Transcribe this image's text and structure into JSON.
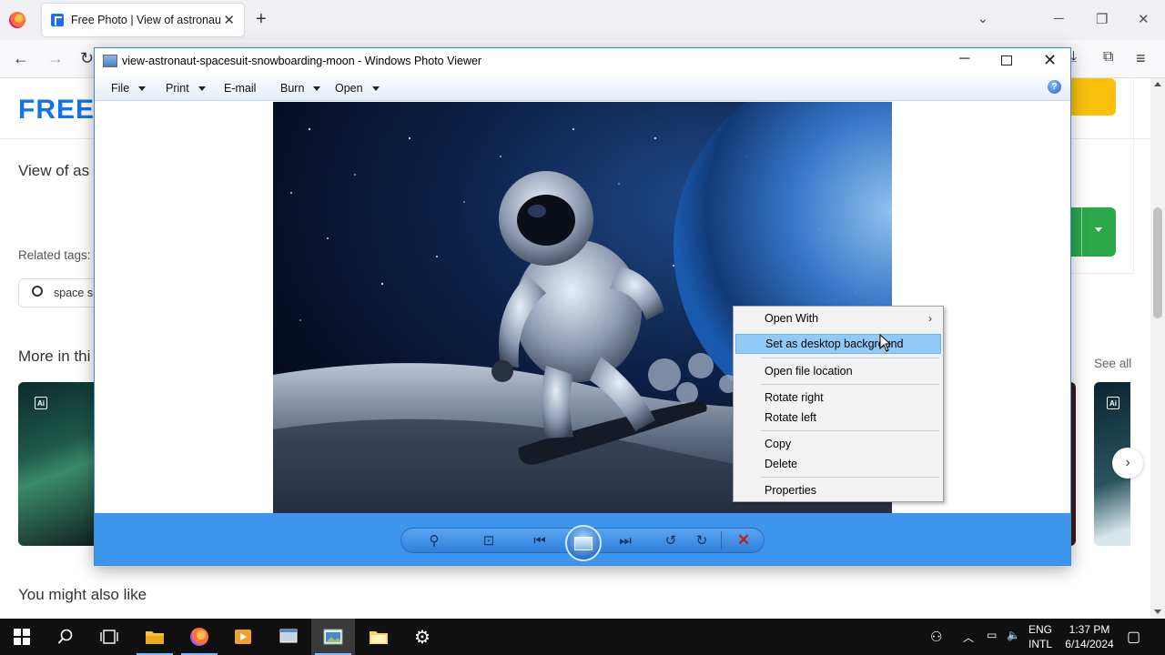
{
  "browser": {
    "tab_title": "Free Photo | View of astronaut i",
    "tab_close": "✕",
    "new_tab": "+"
  },
  "page": {
    "logo": "FREE",
    "view_title": "View of as",
    "related_tags_label": "Related tags:",
    "tag_text": "space s",
    "more_in": "More in thi",
    "see_all": "See all",
    "you_might_like": "You might also like",
    "ai_badge": "Ai"
  },
  "photo_viewer": {
    "title": "view-astronaut-spacesuit-snowboarding-moon - Windows Photo Viewer",
    "menus": [
      {
        "label": "File",
        "has_dropdown": true
      },
      {
        "label": "Print",
        "has_dropdown": true
      },
      {
        "label": "E-mail",
        "has_dropdown": false
      },
      {
        "label": "Burn",
        "has_dropdown": true
      },
      {
        "label": "Open",
        "has_dropdown": true
      }
    ],
    "help": "?"
  },
  "context_menu": {
    "items": [
      {
        "label": "Open With",
        "submenu": true
      },
      {
        "label": "Set as desktop background",
        "highlighted": true
      },
      {
        "label": "Open file location"
      },
      {
        "label": "Rotate right"
      },
      {
        "label": "Rotate left"
      },
      {
        "label": "Copy"
      },
      {
        "label": "Delete"
      },
      {
        "label": "Properties"
      }
    ]
  },
  "taskbar": {
    "lang_top": "ENG",
    "lang_bottom": "INTL",
    "time": "1:37 PM",
    "date": "6/14/2024"
  },
  "colors": {
    "viewer_toolbar": "#3d95ec",
    "context_highlight": "#91c9f7",
    "brand_blue": "#1273eb",
    "green_button": "#2aa84a",
    "yellow_button": "#f9c00c"
  }
}
